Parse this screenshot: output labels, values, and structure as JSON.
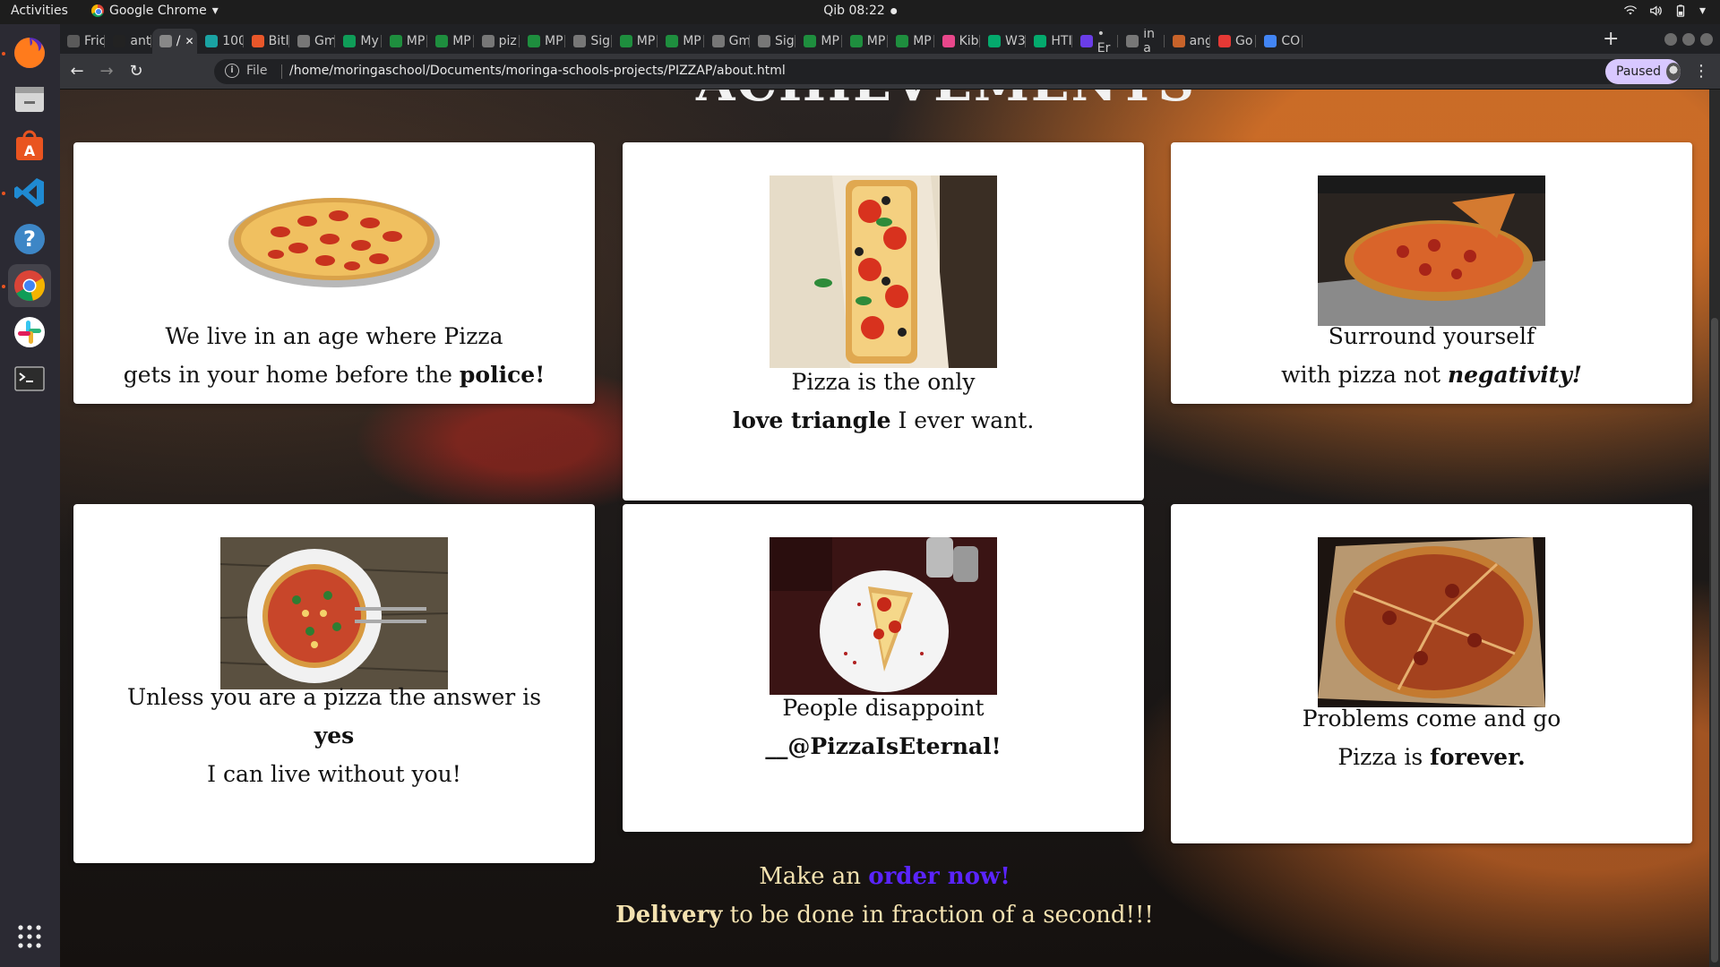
{
  "topbar": {
    "activities": "Activities",
    "app_name": "Google Chrome",
    "clock": "Qib 08:22"
  },
  "tabs": [
    {
      "label": "Fric",
      "fav_color": "#5a5a5a"
    },
    {
      "label": "ant",
      "fav_color": "#222222"
    },
    {
      "label": "/",
      "fav_color": "#888888",
      "active": true
    },
    {
      "label": "100",
      "fav_color": "#1aa3a3"
    },
    {
      "label": "Bitl",
      "fav_color": "#e8572a"
    },
    {
      "label": "Gm",
      "fav_color": "#777777"
    },
    {
      "label": "My",
      "fav_color": "#0f9d58"
    },
    {
      "label": "MP",
      "fav_color": "#1e8e3e"
    },
    {
      "label": "MP",
      "fav_color": "#1e8e3e"
    },
    {
      "label": "piz",
      "fav_color": "#777777"
    },
    {
      "label": "MP",
      "fav_color": "#1e8e3e"
    },
    {
      "label": "Sig",
      "fav_color": "#777777"
    },
    {
      "label": "MP",
      "fav_color": "#1e8e3e"
    },
    {
      "label": "MP",
      "fav_color": "#1e8e3e"
    },
    {
      "label": "Gm",
      "fav_color": "#777777"
    },
    {
      "label": "Sig",
      "fav_color": "#777777"
    },
    {
      "label": "MP",
      "fav_color": "#1e8e3e"
    },
    {
      "label": "MP",
      "fav_color": "#1e8e3e"
    },
    {
      "label": "MP",
      "fav_color": "#1e8e3e"
    },
    {
      "label": "Kib",
      "fav_color": "#e8478b"
    },
    {
      "label": "W3",
      "fav_color": "#04aa6d"
    },
    {
      "label": "HTI",
      "fav_color": "#04aa6d"
    },
    {
      "label": "• Er",
      "fav_color": "#6a3de8"
    },
    {
      "label": "in a",
      "fav_color": "#777777"
    },
    {
      "label": "ang",
      "fav_color": "#c8632a"
    },
    {
      "label": "Go",
      "fav_color": "#e53935"
    },
    {
      "label": "CO",
      "fav_color": "#4285f4"
    }
  ],
  "toolbar": {
    "scheme": "File",
    "url": "/home/moringaschool/Documents/moringa-schools-projects/PIZZAP/about.html",
    "profile": "Paused"
  },
  "page": {
    "hero_title": "ACHIEVEMENTS",
    "cards": [
      {
        "line1": "We live in an age where Pizza",
        "line2_pre": "gets in your home before the ",
        "line2_bold": "police!"
      },
      {
        "line1": "Pizza is the only",
        "line2_bold": "love triangle",
        "line2_post": " I ever want."
      },
      {
        "line1": "Surround yourself",
        "line2_pre": "with pizza not ",
        "line2_italic": "negativity!"
      },
      {
        "line1": "Unless you are a pizza the answer is",
        "line2_bold": "yes",
        "line3": "I can live without you!"
      },
      {
        "line1": "People disappoint",
        "line2_bold": "__@PizzaIsEternal!"
      },
      {
        "line1": "Problems come and go",
        "line2_pre": "Pizza is ",
        "line2_bold": "forever."
      }
    ],
    "footer": {
      "pre": "Make an ",
      "link": "order now!",
      "line2_bold": "Delivery",
      "line2_post": " to be done in fraction of a second!!!"
    }
  }
}
